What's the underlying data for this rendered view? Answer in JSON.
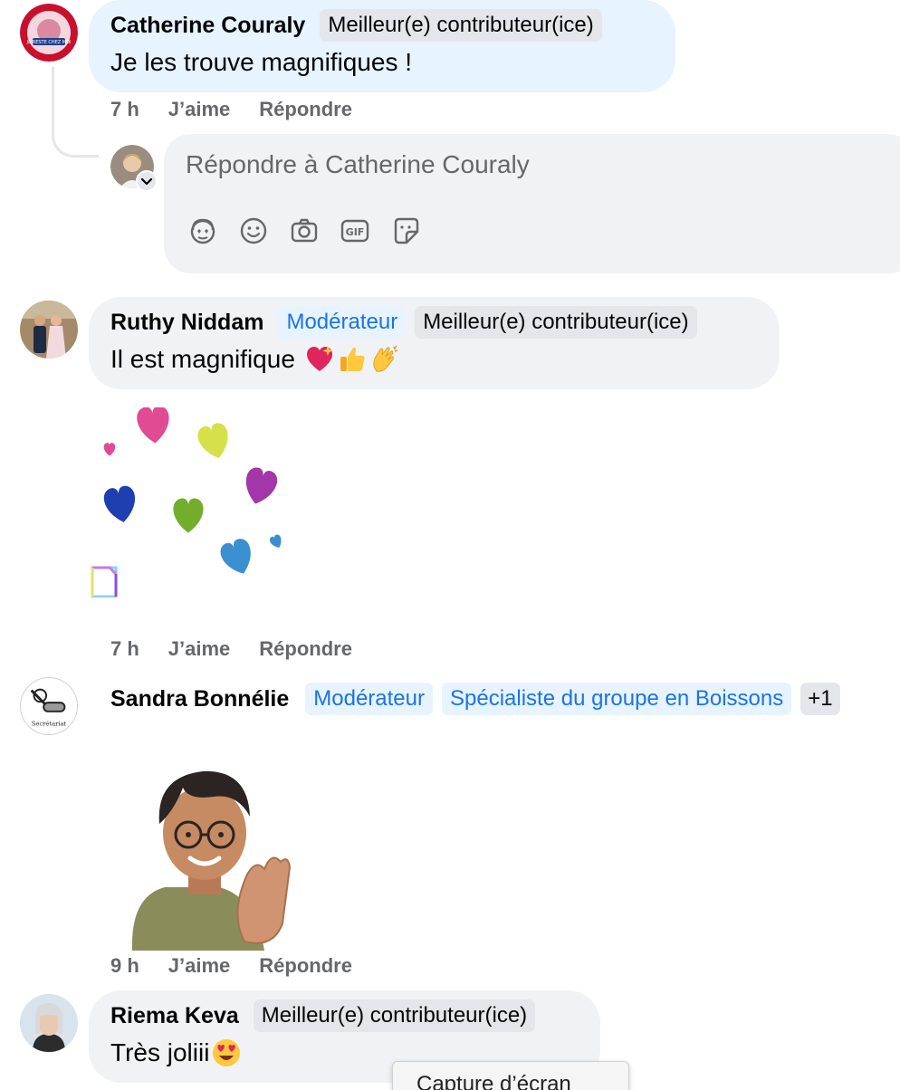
{
  "comments": [
    {
      "author": "Catherine Couraly",
      "badges": [
        "Meilleur(e) contributeur(ice)"
      ],
      "text": "Je les trouve magnifiques !",
      "time": "7 h",
      "like_label": "J’aime",
      "reply_label": "Répondre",
      "avatar_text": "JE RESTE CHEZ MOI"
    },
    {
      "author": "Ruthy Niddam",
      "badges": [
        "Modérateur",
        "Meilleur(e) contributeur(ice)"
      ],
      "text": "Il est magnifique",
      "emojis": [
        "sparkling-heart-icon",
        "thumbs-up-icon",
        "clapping-hands-icon"
      ],
      "time": "7 h",
      "like_label": "J’aime",
      "reply_label": "Répondre",
      "attachment": "hearts-sticker"
    },
    {
      "author": "Sandra Bonnélie",
      "badges": [
        "Modérateur",
        "Spécialiste du groupe en Boissons",
        "+1"
      ],
      "time": "9 h",
      "like_label": "J’aime",
      "reply_label": "Répondre",
      "avatar_text": "Secrétariat",
      "attachment": "avatar-clapping-sticker"
    },
    {
      "author": "Riema Keva",
      "badges": [
        "Meilleur(e) contributeur(ice)"
      ],
      "text": "Très joliii",
      "emojis": [
        "heart-eyes-icon"
      ]
    }
  ],
  "reply_box": {
    "placeholder": "Répondre à Catherine Couraly",
    "icons": [
      "avatar-sticker-icon",
      "emoji-icon",
      "camera-icon",
      "gif-icon",
      "sticker-icon"
    ]
  },
  "tooltip": "Capture d’écran",
  "colors": {
    "bubble": "#f0f2f5",
    "bubble_highlight": "#e7f3ff",
    "moderator_badge": "#1b74e4",
    "meta_text": "#65676b"
  }
}
